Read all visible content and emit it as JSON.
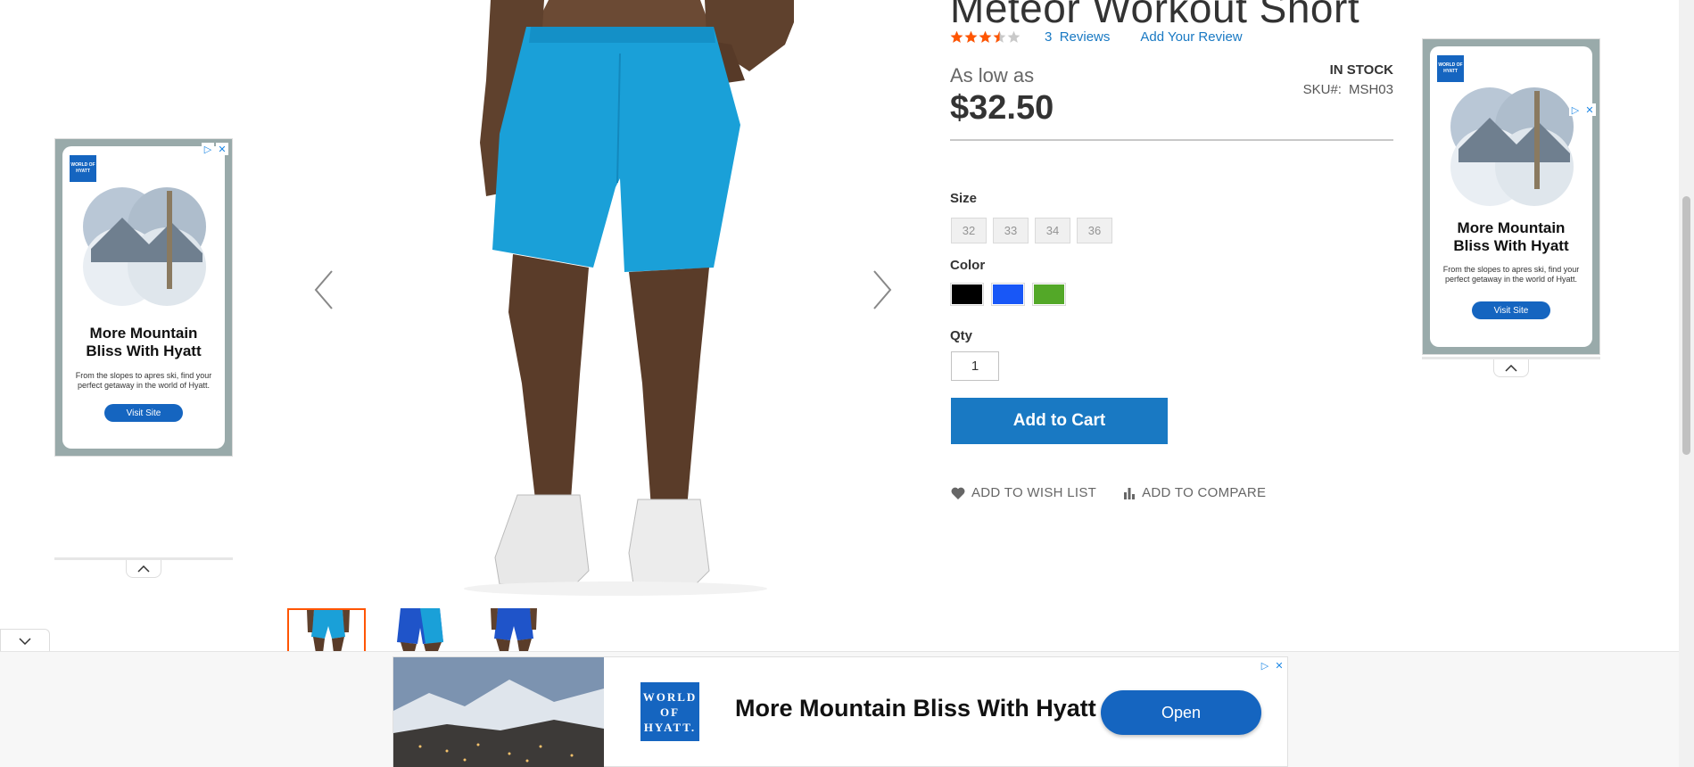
{
  "product": {
    "title": "Meteor Workout Short",
    "rating_percent": 70,
    "reviews_count": "3",
    "reviews_label": "Reviews",
    "add_review": "Add Your Review",
    "as_low_as": "As low as",
    "price": "$32.50",
    "stock": "IN STOCK",
    "sku_label": "SKU#:",
    "sku": "MSH03"
  },
  "options": {
    "size_label": "Size",
    "sizes": [
      "32",
      "33",
      "34",
      "36"
    ],
    "color_label": "Color",
    "colors": [
      "#000000",
      "#1857f7",
      "#53a828"
    ],
    "qty_label": "Qty",
    "qty_value": "1"
  },
  "actions": {
    "add_to_cart": "Add to Cart",
    "wish_list": "Add to Wish List",
    "compare": "Add to Compare"
  },
  "side_ad": {
    "logo_text": "WORLD OF HYATT",
    "headline_1": "More Mountain",
    "headline_2": "Bliss With Hyatt",
    "sub_1": "From the slopes to apres ski, find your",
    "sub_2": "perfect getaway in the world of Hyatt.",
    "cta": "Visit Site"
  },
  "banner_ad": {
    "logo_line_1": "WORLD",
    "logo_line_2": "OF",
    "logo_line_3": "HYATT.",
    "headline": "More Mountain Bliss With Hyatt",
    "cta": "Open"
  },
  "colors": {
    "accent": "#1979c3",
    "star": "#ff5501",
    "thumb_active": "#ff5501",
    "ad_blue": "#1565c0"
  }
}
